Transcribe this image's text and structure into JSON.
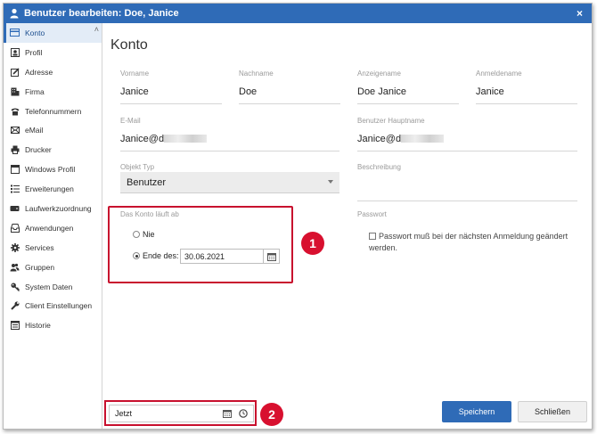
{
  "window": {
    "title": "Benutzer bearbeiten: Doe, Janice",
    "close_glyph": "×"
  },
  "sidebar": {
    "collapse_glyph": "˄",
    "items": [
      {
        "label": "Konto",
        "icon": "card-icon",
        "active": true
      },
      {
        "label": "Profil",
        "icon": "profile-icon"
      },
      {
        "label": "Adresse",
        "icon": "edit-icon"
      },
      {
        "label": "Firma",
        "icon": "building-icon"
      },
      {
        "label": "Telefonnummern",
        "icon": "phone-icon"
      },
      {
        "label": "eMail",
        "icon": "mail-icon"
      },
      {
        "label": "Drucker",
        "icon": "printer-icon"
      },
      {
        "label": "Windows Profil",
        "icon": "window-icon"
      },
      {
        "label": "Erweiterungen",
        "icon": "list-icon"
      },
      {
        "label": "Laufwerkzuordnung",
        "icon": "drive-icon"
      },
      {
        "label": "Anwendungen",
        "icon": "inbox-icon"
      },
      {
        "label": "Services",
        "icon": "gear-icon"
      },
      {
        "label": "Gruppen",
        "icon": "group-icon"
      },
      {
        "label": "System Daten",
        "icon": "key-icon"
      },
      {
        "label": "Client Einstellungen",
        "icon": "wrench-icon"
      },
      {
        "label": "Historie",
        "icon": "history-icon"
      }
    ]
  },
  "main": {
    "title": "Konto",
    "fields": {
      "vorname": {
        "label": "Vorname",
        "value": "Janice"
      },
      "nachname": {
        "label": "Nachname",
        "value": "Doe"
      },
      "anzeigename": {
        "label": "Anzeigename",
        "value": "Doe Janice"
      },
      "anmeldename": {
        "label": "Anmeldename",
        "value": "Janice"
      },
      "email": {
        "label": "E-Mail",
        "value": "Janice@d"
      },
      "benutzer_hauptname": {
        "label": "Benutzer Hauptname",
        "value": "Janice@d"
      },
      "objekt_typ": {
        "label": "Objekt Typ",
        "value": "Benutzer"
      },
      "beschreibung": {
        "label": "Beschreibung",
        "value": ""
      }
    },
    "account_expiry": {
      "label": "Das Konto läuft ab",
      "option_never": "Nie",
      "option_end": "Ende des:",
      "selected": "end",
      "date": "30.06.2021"
    },
    "password": {
      "label": "Passwort",
      "checkbox_label": "Passwort muß bei der nächsten Anmeldung geändert werden.",
      "checked": false
    },
    "callouts": [
      "1",
      "2"
    ]
  },
  "footer": {
    "time_value": "Jetzt",
    "save_label": "Speichern",
    "close_label": "Schließen"
  },
  "colors": {
    "accent": "#2f6bb7",
    "highlight": "#c8102e"
  }
}
